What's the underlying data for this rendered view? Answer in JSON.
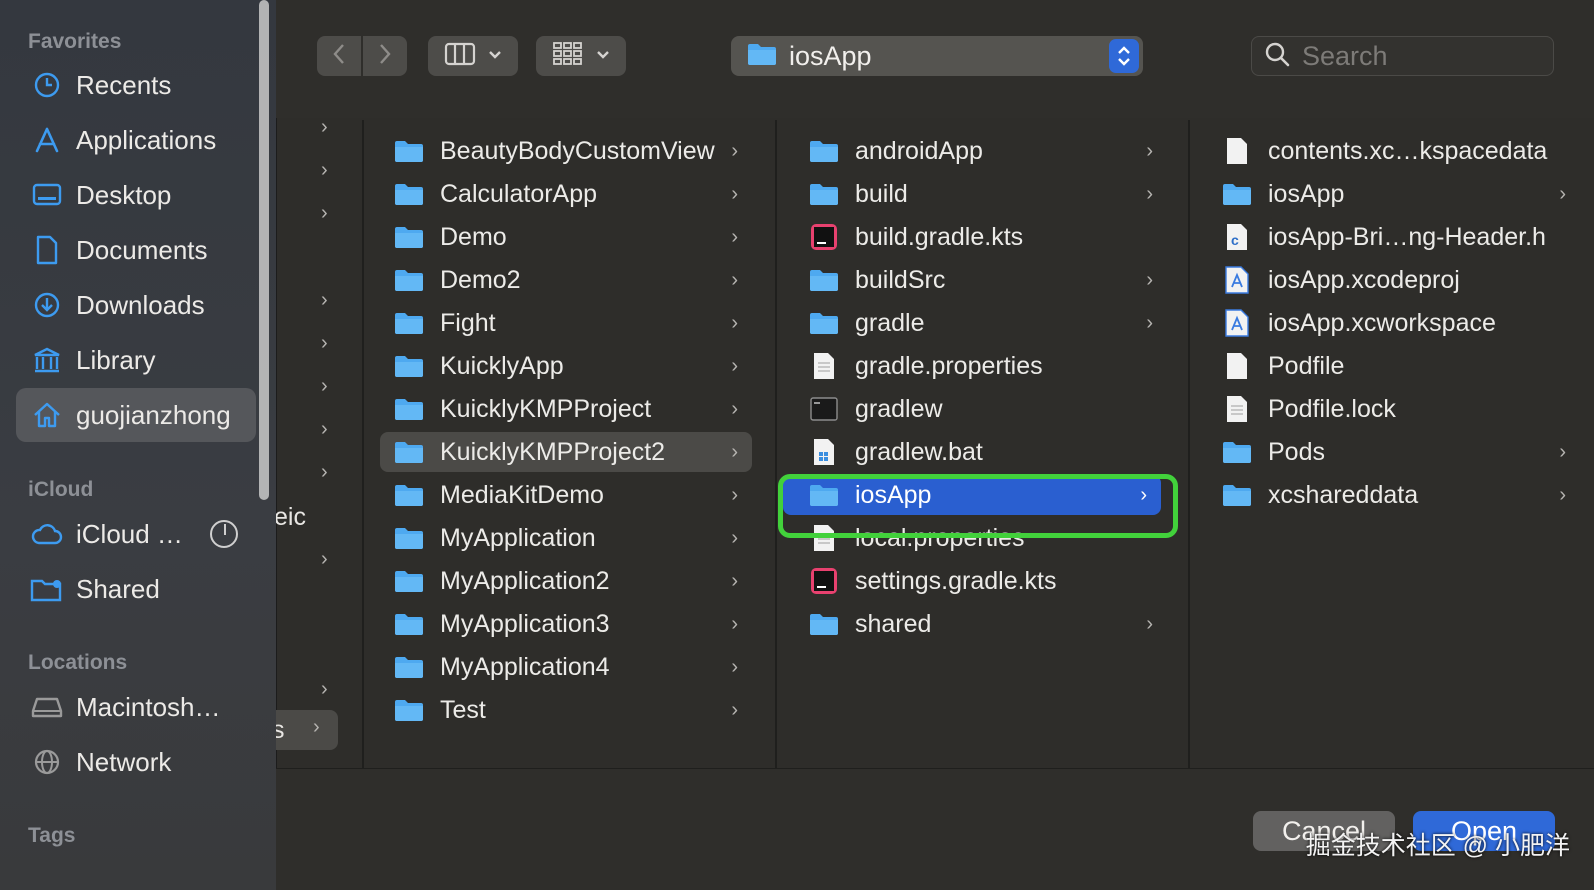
{
  "sidebar": {
    "favorites_heading": "Favorites",
    "favorites": [
      {
        "label": "Recents",
        "icon": "clock-icon"
      },
      {
        "label": "Applications",
        "icon": "applications-icon"
      },
      {
        "label": "Desktop",
        "icon": "desktop-icon"
      },
      {
        "label": "Documents",
        "icon": "document-icon"
      },
      {
        "label": "Downloads",
        "icon": "download-icon"
      },
      {
        "label": "Library",
        "icon": "library-icon"
      },
      {
        "label": "guojianzhong",
        "icon": "home-icon",
        "selected": true
      }
    ],
    "icloud_heading": "iCloud",
    "icloud": [
      {
        "label": "iCloud …",
        "icon": "cloud-icon"
      },
      {
        "label": "Shared",
        "icon": "shared-folder-icon"
      }
    ],
    "locations_heading": "Locations",
    "locations": [
      {
        "label": "Macintosh…",
        "icon": "disk-icon"
      },
      {
        "label": "Network",
        "icon": "network-icon"
      }
    ],
    "tags_heading": "Tags"
  },
  "toolbar": {
    "path_label": "iosApp",
    "search_placeholder": "Search"
  },
  "columns": {
    "col0_fragments": [
      "eic",
      "s"
    ],
    "col1": [
      "BeautyBodyCustomView",
      "CalculatorApp",
      "Demo",
      "Demo2",
      "Fight",
      "KuicklyApp",
      "KuicklyKMPProject",
      "KuicklyKMPProject2",
      "MediaKitDemo",
      "MyApplication",
      "MyApplication2",
      "MyApplication3",
      "MyApplication4",
      "Test"
    ],
    "col1_selected": "KuicklyKMPProject2",
    "col2": [
      {
        "name": "androidApp",
        "type": "folder",
        "chevron": true
      },
      {
        "name": "build",
        "type": "folder",
        "chevron": true
      },
      {
        "name": "build.gradle.kts",
        "type": "intellij"
      },
      {
        "name": "buildSrc",
        "type": "folder",
        "chevron": true
      },
      {
        "name": "gradle",
        "type": "folder",
        "chevron": true
      },
      {
        "name": "gradle.properties",
        "type": "text"
      },
      {
        "name": "gradlew",
        "type": "terminal"
      },
      {
        "name": "gradlew.bat",
        "type": "windows"
      },
      {
        "name": "iosApp",
        "type": "folder",
        "chevron": true,
        "selected": true
      },
      {
        "name": "local.properties",
        "type": "text"
      },
      {
        "name": "settings.gradle.kts",
        "type": "intellij"
      },
      {
        "name": "shared",
        "type": "folder",
        "chevron": true
      }
    ],
    "col3": [
      {
        "name": "contents.xc…kspacedata",
        "type": "blank"
      },
      {
        "name": "iosApp",
        "type": "folder",
        "chevron": true
      },
      {
        "name": "iosApp-Bri…ng-Header.h",
        "type": "c-header"
      },
      {
        "name": "iosApp.xcodeproj",
        "type": "xcode"
      },
      {
        "name": "iosApp.xcworkspace",
        "type": "xcode"
      },
      {
        "name": "Podfile",
        "type": "blank"
      },
      {
        "name": "Podfile.lock",
        "type": "text"
      },
      {
        "name": "Pods",
        "type": "folder",
        "chevron": true
      },
      {
        "name": "xcshareddata",
        "type": "folder",
        "chevron": true
      }
    ]
  },
  "buttons": {
    "cancel": "Cancel",
    "open": "Open"
  },
  "watermark": "掘金技术社区 @ 小肥洋",
  "colors": {
    "accent": "#2f69d8",
    "highlight": "#42d13b",
    "folder": "#4ea9f0"
  }
}
